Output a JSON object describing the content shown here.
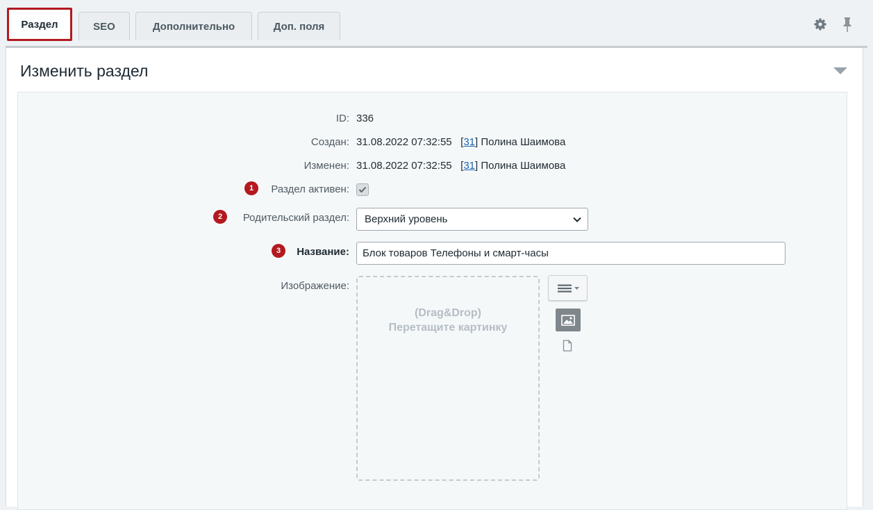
{
  "tabs": [
    {
      "label": "Раздел",
      "active": true
    },
    {
      "label": "SEO",
      "active": false
    },
    {
      "label": "Дополнительно",
      "active": false
    },
    {
      "label": "Доп. поля",
      "active": false
    }
  ],
  "toolbar": {
    "settings_icon": "gear-icon",
    "pin_icon": "pin-icon"
  },
  "panel": {
    "title": "Изменить раздел",
    "collapse_icon": "triangle-down-icon"
  },
  "fields": {
    "id": {
      "label": "ID:",
      "value": "336"
    },
    "created": {
      "label": "Создан:",
      "datetime": "31.08.2022 07:32:55",
      "user_id": "31",
      "user_name": "Полина Шаимова"
    },
    "modified": {
      "label": "Изменен:",
      "datetime": "31.08.2022 07:32:55",
      "user_id": "31",
      "user_name": "Полина Шаимова"
    },
    "active": {
      "badge": "1",
      "label": "Раздел активен:",
      "checked": true
    },
    "parent": {
      "badge": "2",
      "label": "Родительский раздел:",
      "selected": "Верхний уровень"
    },
    "name": {
      "badge": "3",
      "label": "Название:",
      "value": "Блок товаров Телефоны и смарт-часы"
    },
    "image": {
      "label": "Изображение:",
      "drop_line1": "(Drag&Drop)",
      "drop_line2": "Перетащите картинку"
    }
  },
  "colors": {
    "accent": "#b3191e",
    "link": "#2067b0"
  }
}
